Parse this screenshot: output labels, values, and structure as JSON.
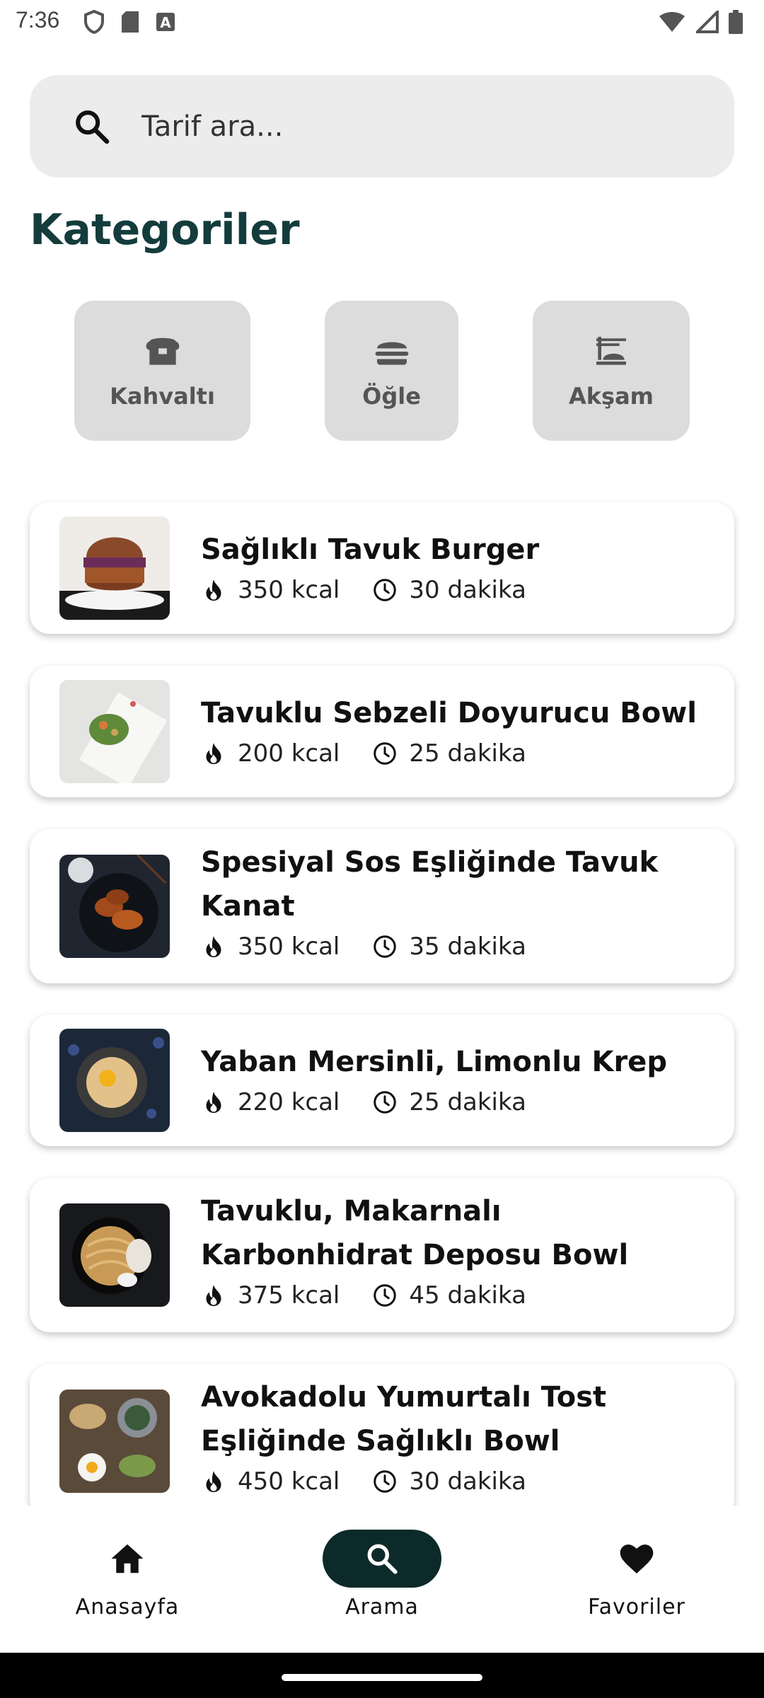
{
  "status": {
    "time": "7:36",
    "icons_left": [
      "shield-icon",
      "sd-card-icon",
      "a-icon"
    ],
    "icons_right": [
      "wifi-icon",
      "signal-icon",
      "battery-icon"
    ]
  },
  "search": {
    "placeholder": "Tarif ara..."
  },
  "section_title": "Kategoriler",
  "categories": [
    {
      "label": "Kahvaltı",
      "icon": "bread-icon"
    },
    {
      "label": "Öğle",
      "icon": "burger-icon"
    },
    {
      "label": "Akşam",
      "icon": "dinner-icon"
    }
  ],
  "recipes": [
    {
      "title": "Sağlıklı Tavuk Burger",
      "kcal": "350 kcal",
      "time": "30 dakika"
    },
    {
      "title": "Tavuklu Sebzeli Doyurucu Bowl",
      "kcal": "200 kcal",
      "time": "25 dakika"
    },
    {
      "title": "Spesiyal Sos Eşliğinde Tavuk Kanat",
      "kcal": "350 kcal",
      "time": "35 dakika"
    },
    {
      "title": "Yaban Mersinli, Limonlu Krep",
      "kcal": "220 kcal",
      "time": "25 dakika"
    },
    {
      "title": "Tavuklu, Makarnalı Karbonhidrat Deposu Bowl",
      "kcal": "375 kcal",
      "time": "45 dakika"
    },
    {
      "title": "Avokadolu Yumurtalı Tost Eşliğinde Sağlıklı Bowl",
      "kcal": "450 kcal",
      "time": "30 dakika"
    }
  ],
  "nav": [
    {
      "label": "Anasayfa",
      "icon": "home-icon",
      "active": false
    },
    {
      "label": "Arama",
      "icon": "search-icon",
      "active": true
    },
    {
      "label": "Favoriler",
      "icon": "heart-icon",
      "active": false
    }
  ],
  "colors": {
    "accent": "#0d2a2a",
    "title": "#143c3c",
    "search_bg": "#ececec",
    "category_bg": "#dcdcdc"
  }
}
